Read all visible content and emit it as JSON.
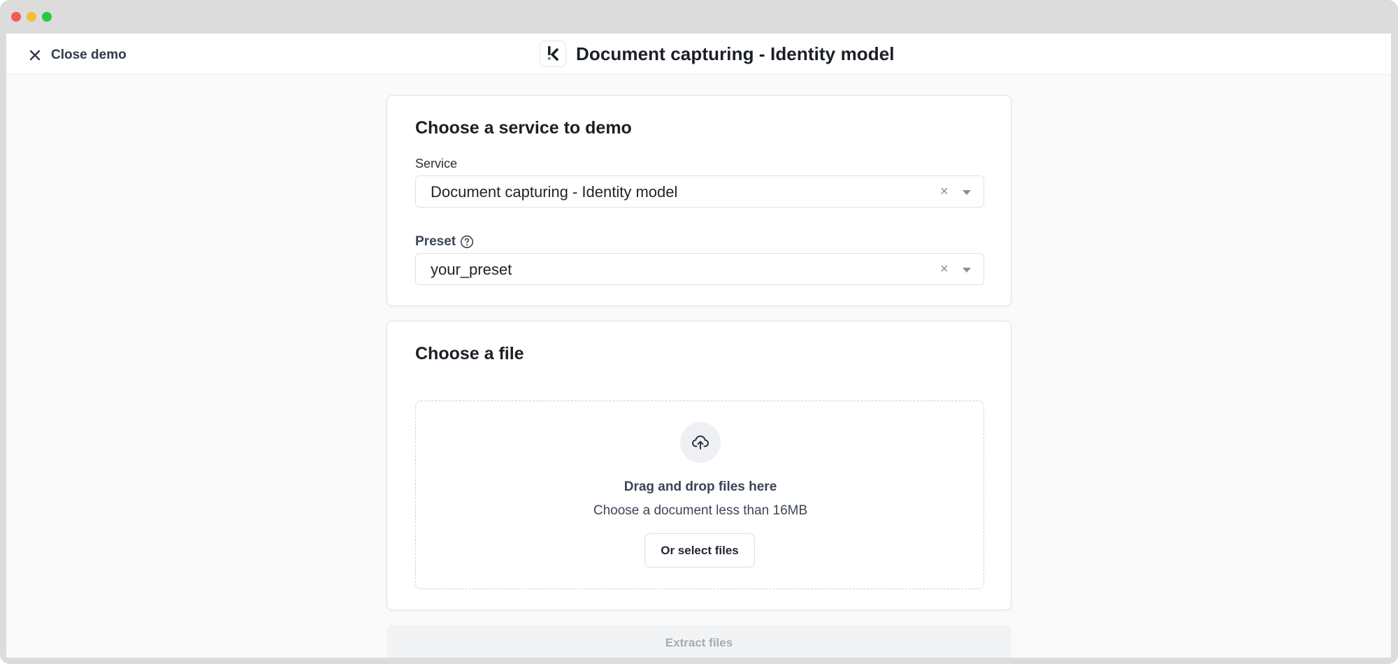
{
  "window": {
    "controls": [
      "close",
      "minimize",
      "maximize"
    ],
    "colors": {
      "close": "#ef5f57",
      "minimize": "#f5bd2f",
      "maximize": "#2ac840"
    }
  },
  "header": {
    "close_label": "Close demo",
    "close_icon": "close-icon",
    "logo_icon": "klippa-logo-icon",
    "title": "Document capturing - Identity model"
  },
  "service_card": {
    "title": "Choose a service to demo",
    "service_label": "Service",
    "service_value": "Document capturing - Identity model",
    "preset_label": "Preset",
    "preset_help_icon": "question-circle-icon",
    "preset_value": "your_preset",
    "clear_glyph": "×"
  },
  "file_card": {
    "title": "Choose a file",
    "upload_icon": "cloud-upload-icon",
    "drop_title": "Drag and drop files here",
    "drop_subtitle": "Choose a document less than 16MB",
    "select_button": "Or select files"
  },
  "actions": {
    "extract_label": "Extract files",
    "extract_enabled": false
  },
  "colors": {
    "accent_green": "#22b14c",
    "text_dark": "#1b1f27",
    "disabled_text": "#a6abb3"
  }
}
